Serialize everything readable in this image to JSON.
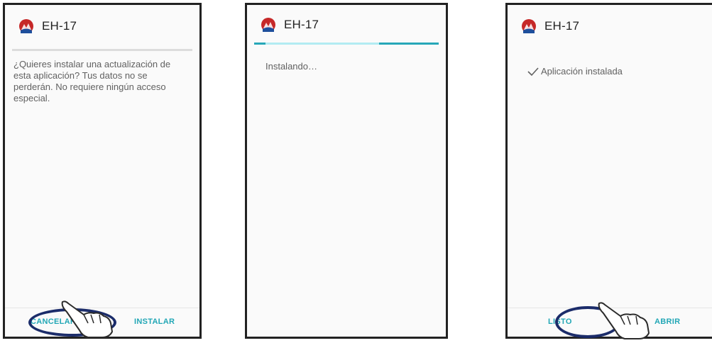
{
  "app": {
    "title": "EH-17",
    "icon": "app-logo-icon",
    "icon_color": "#c62828"
  },
  "panels": [
    {
      "message": "¿Quieres instalar una actualización de esta aplicación? Tus datos no se perderán. No requiere ningún acceso especial.",
      "buttons": {
        "cancel": "CANCELAR",
        "install": "INSTALAR"
      }
    },
    {
      "status": "Instalando…"
    },
    {
      "status": "Aplicación instalada",
      "status_icon": "checkmark-icon",
      "buttons": {
        "done": "LISTO",
        "open": "ABRIR"
      }
    }
  ],
  "colors": {
    "accent": "#22a7b6",
    "annotation": "#1b2c6a"
  }
}
